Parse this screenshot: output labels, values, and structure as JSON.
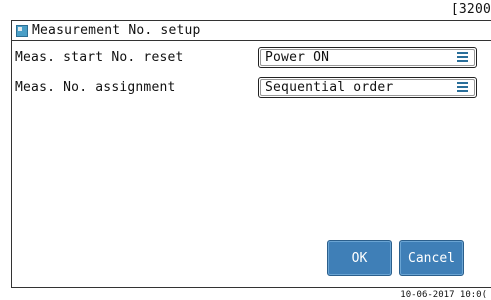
{
  "header": {
    "title": "Measurement No. setup",
    "screen_code": "[3200"
  },
  "settings": [
    {
      "label": "Meas. start No. reset",
      "value": "Power ON"
    },
    {
      "label": "Meas. No. assignment",
      "value": "Sequential order"
    }
  ],
  "buttons": {
    "ok": "OK",
    "cancel": "Cancel"
  },
  "footer": {
    "timestamp": "10-06-2017 10:0("
  },
  "colors": {
    "button_fill": "#3f7fb7",
    "menu_icon": "#2a6f9a",
    "title_icon": "#4a9fc7"
  }
}
